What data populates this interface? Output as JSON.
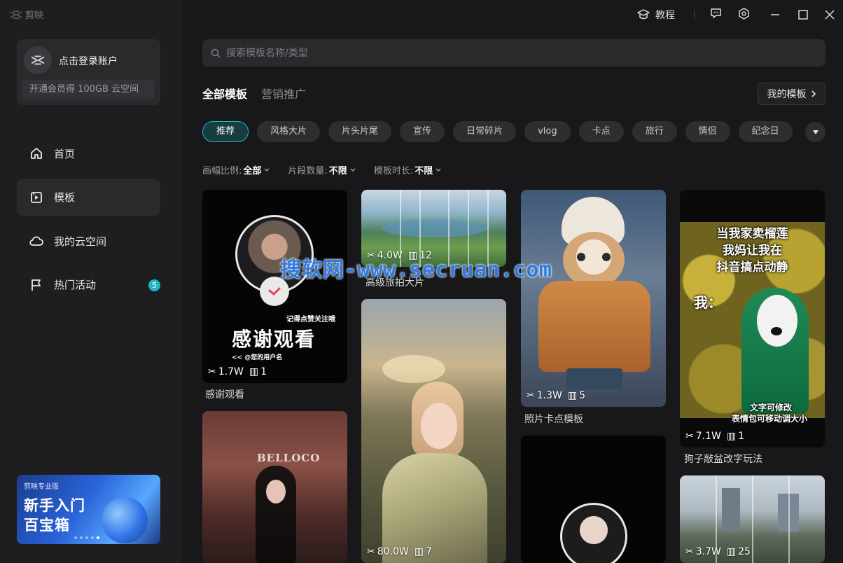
{
  "app": {
    "name": "剪映"
  },
  "titlebar": {
    "tutorial": "教程"
  },
  "sidebar": {
    "login": {
      "title": "点击登录账户",
      "vip_promo": "开通会员得 100GB 云空间"
    },
    "items": [
      {
        "label": "首页",
        "icon": "home-icon"
      },
      {
        "label": "模板",
        "icon": "template-icon",
        "active": true
      },
      {
        "label": "我的云空间",
        "icon": "cloud-icon"
      },
      {
        "label": "热门活动",
        "icon": "flag-icon",
        "badge": "5"
      }
    ],
    "banner": {
      "brand": "剪映专业版",
      "line1": "新手入门",
      "line2": "百宝箱"
    }
  },
  "search": {
    "placeholder": "搜索模板名称/类型"
  },
  "tabs": [
    {
      "label": "全部模板",
      "active": true
    },
    {
      "label": "营销推广"
    }
  ],
  "my_templates_label": "我的模板",
  "chips": [
    "推荐",
    "风格大片",
    "片头片尾",
    "宣传",
    "日常碎片",
    "vlog",
    "卡点",
    "旅行",
    "情侣",
    "纪念日"
  ],
  "filters": [
    {
      "label": "画幅比例:",
      "value": "全部"
    },
    {
      "label": "片段数量:",
      "value": "不限"
    },
    {
      "label": "模板时长:",
      "value": "不限"
    }
  ],
  "cards": [
    {
      "title": "感谢观看",
      "uses": "1.7W",
      "clips": "1",
      "overlay_top": "记得点赞关注哦",
      "overlay_main": "感谢观看",
      "overlay_sub": "<< @您的用户名"
    },
    {
      "title": "高级旅拍大片",
      "uses": "4.0W",
      "clips": "12"
    },
    {
      "title": "照片卡点模板",
      "uses": "1.3W",
      "clips": "5"
    },
    {
      "title": "狗子敲盆改字玩法",
      "uses": "7.1W",
      "clips": "1",
      "overlay_line1": "当我家卖榴莲",
      "overlay_line2": "我妈让我在",
      "overlay_line3": "抖音搞点动静",
      "overlay_me": "我：",
      "overlay_note1": "文字可修改",
      "overlay_note2": "表情包可移动调大小"
    },
    {
      "title": "",
      "uses": "",
      "clips": ""
    },
    {
      "title": "",
      "uses": "80.0W",
      "clips": "7"
    },
    {
      "title": "",
      "uses": "",
      "clips": ""
    },
    {
      "title": "",
      "uses": "3.7W",
      "clips": "25"
    }
  ],
  "watermark": "搜软网-www.secruan.com"
}
